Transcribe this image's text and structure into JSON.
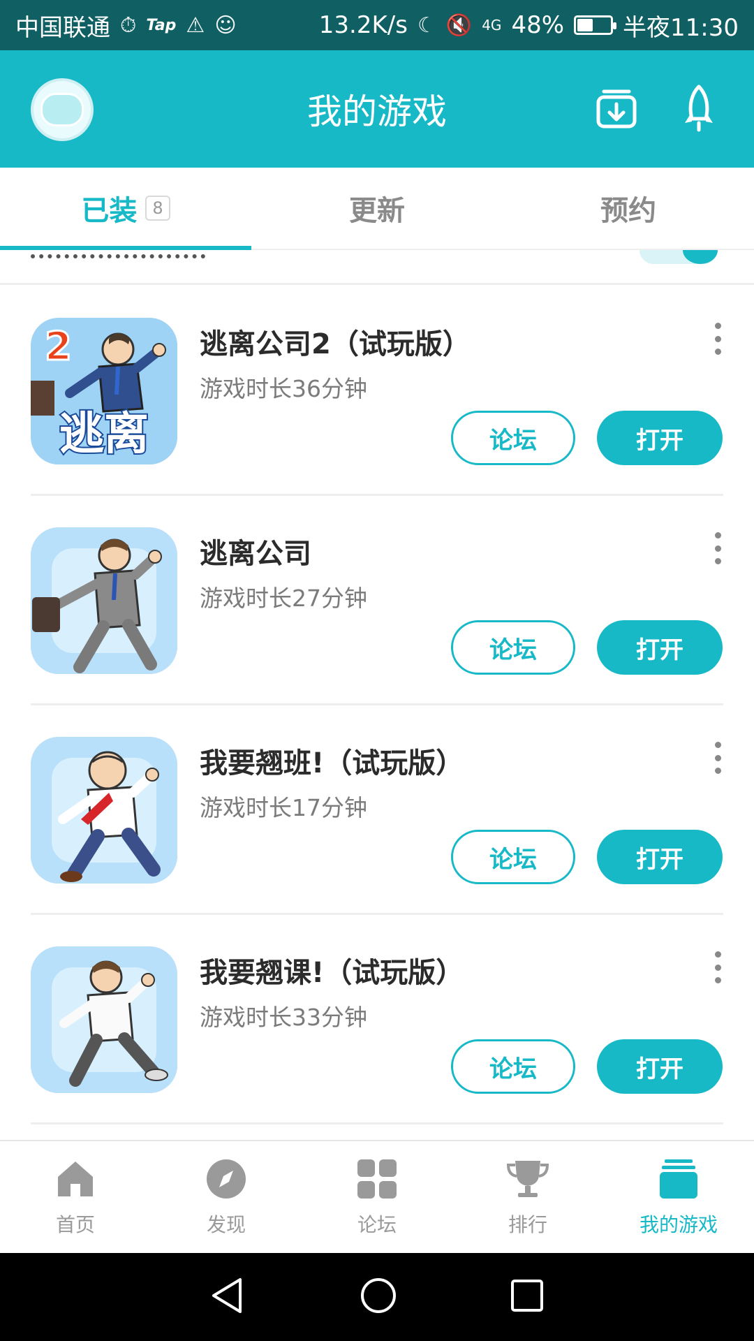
{
  "status_bar": {
    "carrier": "中国联通",
    "tap_label": "Tap",
    "network_speed": "13.2K/s",
    "signal_text": "4G",
    "battery_percent": "48%",
    "battery_level": 0.48,
    "time": "半夜11:30"
  },
  "header": {
    "title": "我的游戏"
  },
  "tabs": [
    {
      "label": "已装",
      "count": "8",
      "active": true
    },
    {
      "label": "更新",
      "active": false
    },
    {
      "label": "预约",
      "active": false
    }
  ],
  "games": [
    {
      "name": "逃离公司2（试玩版）",
      "play_time": "游戏时长36分钟",
      "forum_label": "论坛",
      "open_label": "打开",
      "icon_text": "逃离",
      "icon_badge": "2"
    },
    {
      "name": "逃离公司",
      "play_time": "游戏时长27分钟",
      "forum_label": "论坛",
      "open_label": "打开"
    },
    {
      "name": "我要翘班!（试玩版）",
      "play_time": "游戏时长17分钟",
      "forum_label": "论坛",
      "open_label": "打开"
    },
    {
      "name": "我要翘课!（试玩版）",
      "play_time": "游戏时长33分钟",
      "forum_label": "论坛",
      "open_label": "打开"
    }
  ],
  "bottom_nav": [
    {
      "label": "首页",
      "icon": "home-icon",
      "active": false
    },
    {
      "label": "发现",
      "icon": "compass-icon",
      "active": false
    },
    {
      "label": "论坛",
      "icon": "grid-icon",
      "active": false
    },
    {
      "label": "排行",
      "icon": "trophy-icon",
      "active": false
    },
    {
      "label": "我的游戏",
      "icon": "stack-icon",
      "active": true
    }
  ],
  "colors": {
    "accent": "#18b9c7",
    "status_bar": "#0f5f63"
  }
}
